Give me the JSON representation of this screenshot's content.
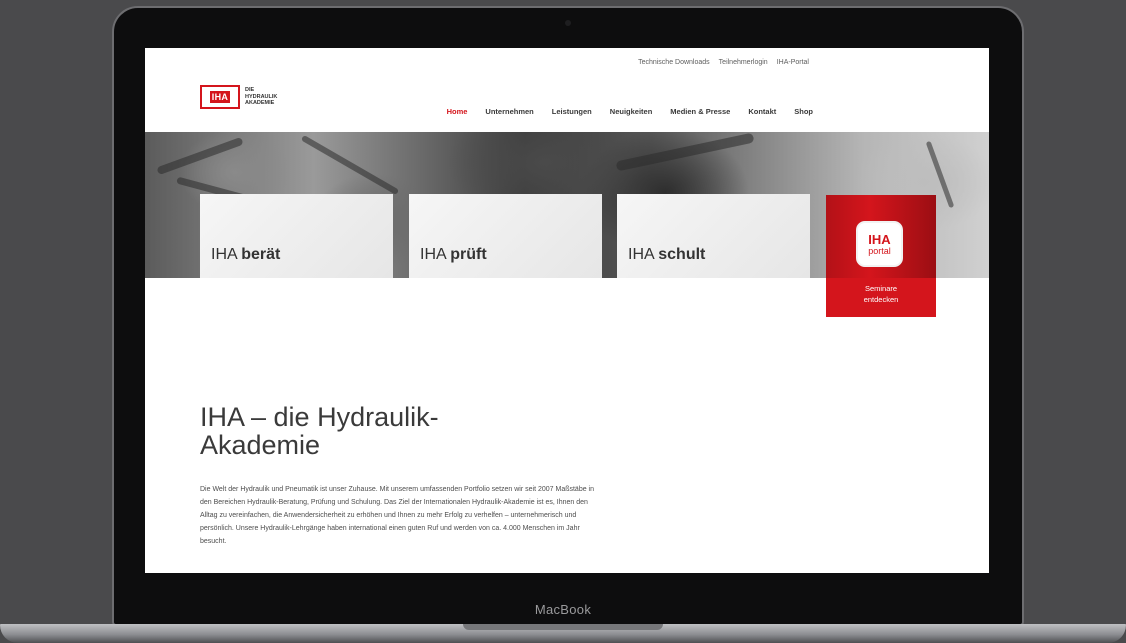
{
  "device": {
    "brand_label": "MacBook"
  },
  "topbar": {
    "links": [
      "Technische Downloads",
      "Teilnehmerlogin",
      "IHA-Portal"
    ]
  },
  "logo": {
    "mark": "IHA",
    "text": "DIE\nHYDRAULIK\nAKADEMIE"
  },
  "nav": {
    "items": [
      "Home",
      "Unternehmen",
      "Leistungen",
      "Neuigkeiten",
      "Medien & Presse",
      "Kontakt",
      "Shop"
    ],
    "active": "Home"
  },
  "cards": [
    {
      "prefix": "IHA",
      "word": "berät"
    },
    {
      "prefix": "IHA",
      "word": "prüft"
    },
    {
      "prefix": "IHA",
      "word": "schult"
    }
  ],
  "portal": {
    "icon_line1": "IHA",
    "icon_line2": "portal",
    "cta_line1": "Seminare",
    "cta_line2": "entdecken"
  },
  "intro": {
    "title": "IHA – die Hydraulik-Akademie",
    "text": "Die Welt der Hydraulik und Pneumatik ist unser Zuhause. Mit unserem umfassenden Portfolio setzen wir seit 2007 Maßstäbe in den Bereichen Hydraulik-Beratung, Prüfung und Schulung. Das Ziel der Internationalen Hydraulik-Akademie ist es, Ihnen den Alltag zu vereinfachen, die Anwendersicherheit zu erhöhen und Ihnen zu mehr Erfolg zu verhelfen – unternehmerisch und persönlich. Unsere Hydraulik-Lehrgänge haben international einen guten Ruf und werden von ca. 4.000 Menschen im Jahr besucht."
  },
  "colors": {
    "brand_red": "#d4151c",
    "text_dark": "#3a3a3a",
    "frame": "#0d0d0e"
  }
}
